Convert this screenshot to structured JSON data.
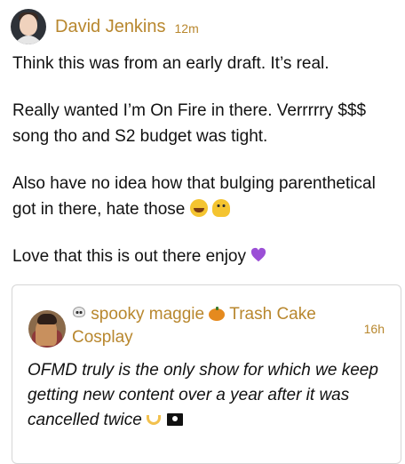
{
  "post": {
    "author": "David Jenkins",
    "time": "12m",
    "paragraphs": {
      "p1": "Think this was from an early draft. It’s real.",
      "p2": "Really wanted I’m On Fire in there. Verrrrry $$$ song tho and S2 budget was tight.",
      "p3": "Also have no idea how that bulging parenthetical got in there, hate those",
      "p4": "Love that this is out there enjoy"
    },
    "icons": {
      "p3_emoji_1": "grinning-sweat-emoji",
      "p3_emoji_2": "melting-face-emoji",
      "p4_emoji": "purple-heart-emoji"
    }
  },
  "quoted": {
    "name_line": "spooky maggie",
    "name_line_2": "Trash Cake",
    "name_line_3": "Cosplay",
    "time": "16h",
    "text": "OFMD truly is the only show for which we keep getting new content over a year after it was cancelled twice",
    "icons": {
      "prefix": "skull-emoji",
      "middle": "pumpkin-emoji",
      "trail_1": "heart-hands-emoji",
      "trail_2": "pirate-flag-emoji"
    }
  }
}
